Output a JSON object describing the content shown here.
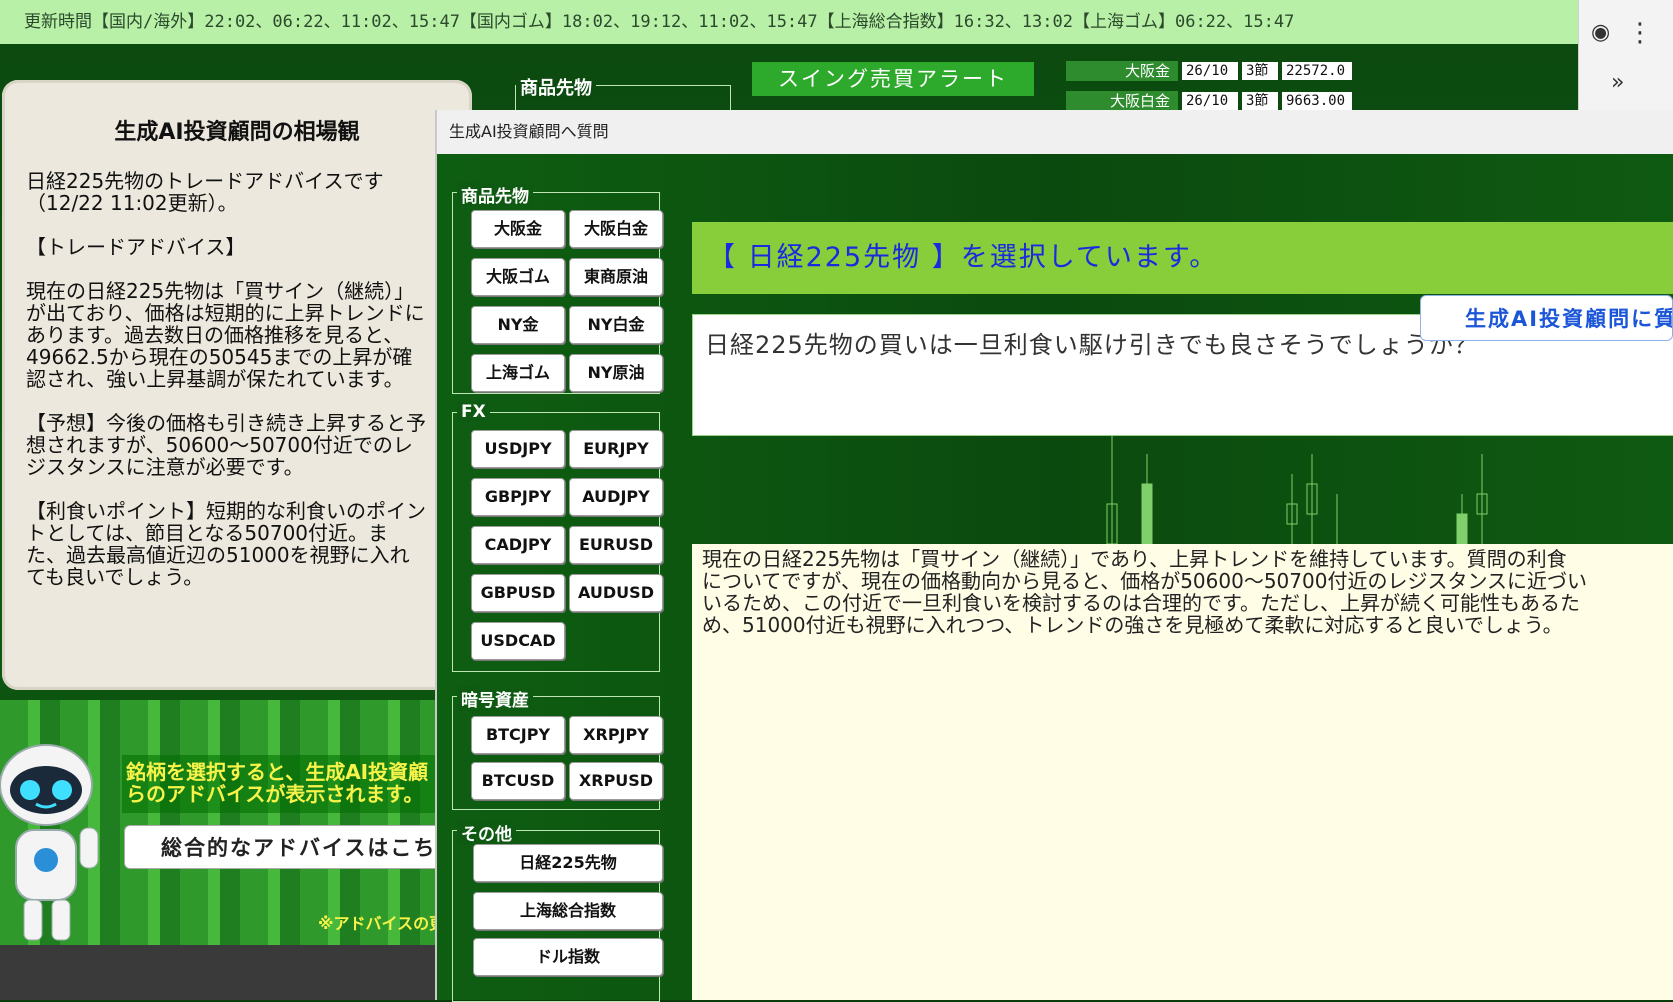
{
  "ticker": "更新時間【国内/海外】22:02、06:22、11:02、15:47【国内ゴム】18:02、19:12、11:02、15:47【上海総合指数】16:32、13:02【上海ゴム】06:22、15:47",
  "browser": {
    "menu_icon": "kebab-menu-icon",
    "overflow_label": "»"
  },
  "advice_panel": {
    "title": "生成AI投資顧問の相場観",
    "text": "日経225先物のトレードアドバイスです（12/22 11:02更新）。\n\n【トレードアドバイス】\n\n現在の日経225先物は「買サイン（継続）」が出ており、価格は短期的に上昇トレンドにあります。過去数日の価格推移を見ると、49662.5から現在の50545までの上昇が確認され、強い上昇基調が保たれています。\n\n【予想】今後の価格も引き続き上昇すると予想されますが、50600～50700付近でのレジスタンスに注意が必要です。\n\n【利食いポイント】短期的な利食いのポイントとしては、節目となる50700付近。また、過去最高値近辺の51000を視野に入れても良いでしょう。"
  },
  "hint": {
    "text": "銘柄を選択すると、生成AI投資顧\nらのアドバイスが表示されます。",
    "button_label": "総合的なアドバイスはこち",
    "note": "※アドバイスの更"
  },
  "background_header": {
    "group_label": "商品先物",
    "alert_button": "スイング売買アラート",
    "prices": [
      {
        "name": "大阪金",
        "contract": "26/10",
        "session": "3節",
        "price": "22572.0"
      },
      {
        "name": "大阪白金",
        "contract": "26/10",
        "session": "3節",
        "price": "9663.00"
      }
    ]
  },
  "dialog": {
    "title": "生成AI投資顧問へ質問",
    "groups": {
      "commodities": {
        "label": "商品先物",
        "items": [
          "大阪金",
          "大阪白金",
          "大阪ゴム",
          "東商原油",
          "NY金",
          "NY白金",
          "上海ゴム",
          "NY原油"
        ]
      },
      "fx": {
        "label": "FX",
        "items": [
          "USDJPY",
          "EURJPY",
          "GBPJPY",
          "AUDJPY",
          "CADJPY",
          "EURUSD",
          "GBPUSD",
          "AUDUSD",
          "USDCAD"
        ]
      },
      "crypto": {
        "label": "暗号資産",
        "items": [
          "BTCJPY",
          "XRPJPY",
          "BTCUSD",
          "XRPUSD"
        ]
      },
      "other": {
        "label": "その他",
        "items": [
          "日経225先物",
          "上海総合指数",
          "ドル指数"
        ]
      }
    },
    "selection_banner": "【 日経225先物 】を選択しています。",
    "question": "日経225先物の買いは一旦利食い駆け引きでも良さそうでしょうか？",
    "ask_button": "生成AI投資顧問に質",
    "answer": "現在の日経225先物は「買サイン（継続）」であり、上昇トレンドを維持しています。質問の利食\nについてですが、現在の価格動向から見ると、価格が50600～50700付近のレジスタンスに近づい\nいるため、この付近で一旦利食いを検討するのは合理的です。ただし、上昇が続く可能性もあるた\nめ、51000付近も視野に入れつつ、トレンドの強さを見極めて柔軟に対応すると良いでしょう。"
  },
  "colors": {
    "accent_green": "#88cd3a",
    "banner_text": "#1b2ae0",
    "ticker_bg": "#b9f0a8"
  }
}
